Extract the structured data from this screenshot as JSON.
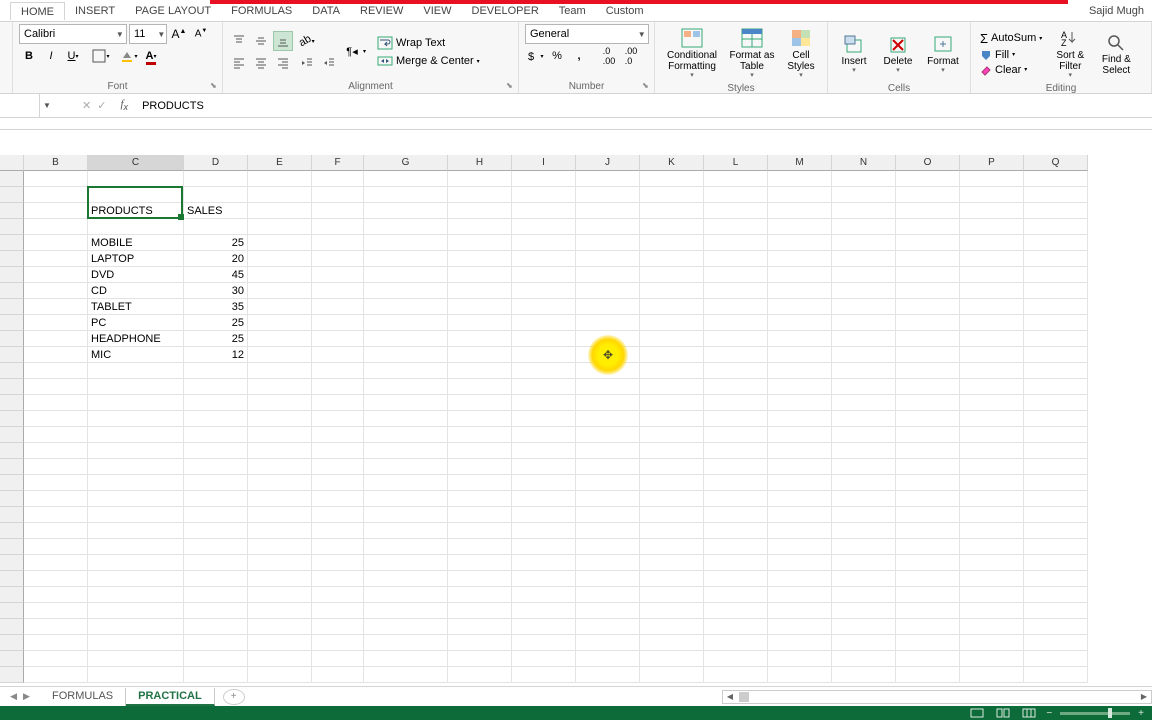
{
  "user": "Sajid Mugh",
  "tabs": [
    "HOME",
    "INSERT",
    "PAGE LAYOUT",
    "FORMULAS",
    "DATA",
    "REVIEW",
    "VIEW",
    "DEVELOPER",
    "Team",
    "Custom"
  ],
  "active_tab": 0,
  "font": {
    "name": "Calibri",
    "size": "11"
  },
  "wrap": "Wrap Text",
  "merge": "Merge & Center",
  "number_format": "General",
  "groups": {
    "font": "Font",
    "alignment": "Alignment",
    "number": "Number",
    "styles": "Styles",
    "cells": "Cells",
    "editing": "Editing"
  },
  "styles": {
    "cf": "Conditional Formatting",
    "fat": "Format as Table",
    "cs": "Cell Styles"
  },
  "cells_grp": {
    "ins": "Insert",
    "del": "Delete",
    "fmt": "Format"
  },
  "editing": {
    "sum": "AutoSum",
    "fill": "Fill",
    "clear": "Clear",
    "sort": "Sort & Filter",
    "find": "Find & Select"
  },
  "formula_bar": "PRODUCTS",
  "columns": [
    {
      "l": "B",
      "w": 64
    },
    {
      "l": "C",
      "w": 96
    },
    {
      "l": "D",
      "w": 64
    },
    {
      "l": "E",
      "w": 64
    },
    {
      "l": "F",
      "w": 52
    },
    {
      "l": "G",
      "w": 84
    },
    {
      "l": "H",
      "w": 64
    },
    {
      "l": "I",
      "w": 64
    },
    {
      "l": "J",
      "w": 64
    },
    {
      "l": "K",
      "w": 64
    },
    {
      "l": "L",
      "w": 64
    },
    {
      "l": "M",
      "w": 64
    },
    {
      "l": "N",
      "w": 64
    },
    {
      "l": "O",
      "w": 64
    },
    {
      "l": "P",
      "w": 64
    },
    {
      "l": "Q",
      "w": 64
    }
  ],
  "selected_col": 1,
  "table": {
    "headers": [
      "PRODUCTS",
      "SALES"
    ],
    "rows": [
      [
        "MOBILE",
        "25"
      ],
      [
        "LAPTOP",
        "20"
      ],
      [
        "DVD",
        "45"
      ],
      [
        "CD",
        "30"
      ],
      [
        "TABLET",
        "35"
      ],
      [
        "PC",
        "25"
      ],
      [
        "HEADPHONE",
        "25"
      ],
      [
        "MIC",
        "12"
      ]
    ]
  },
  "sheets": [
    "FORMULAS",
    "PRACTICAL"
  ],
  "active_sheet": 1,
  "chart_data": {
    "type": "table",
    "categories": [
      "MOBILE",
      "LAPTOP",
      "DVD",
      "CD",
      "TABLET",
      "PC",
      "HEADPHONE",
      "MIC"
    ],
    "values": [
      25,
      20,
      45,
      30,
      35,
      25,
      25,
      12
    ],
    "title": "PRODUCTS / SALES"
  }
}
